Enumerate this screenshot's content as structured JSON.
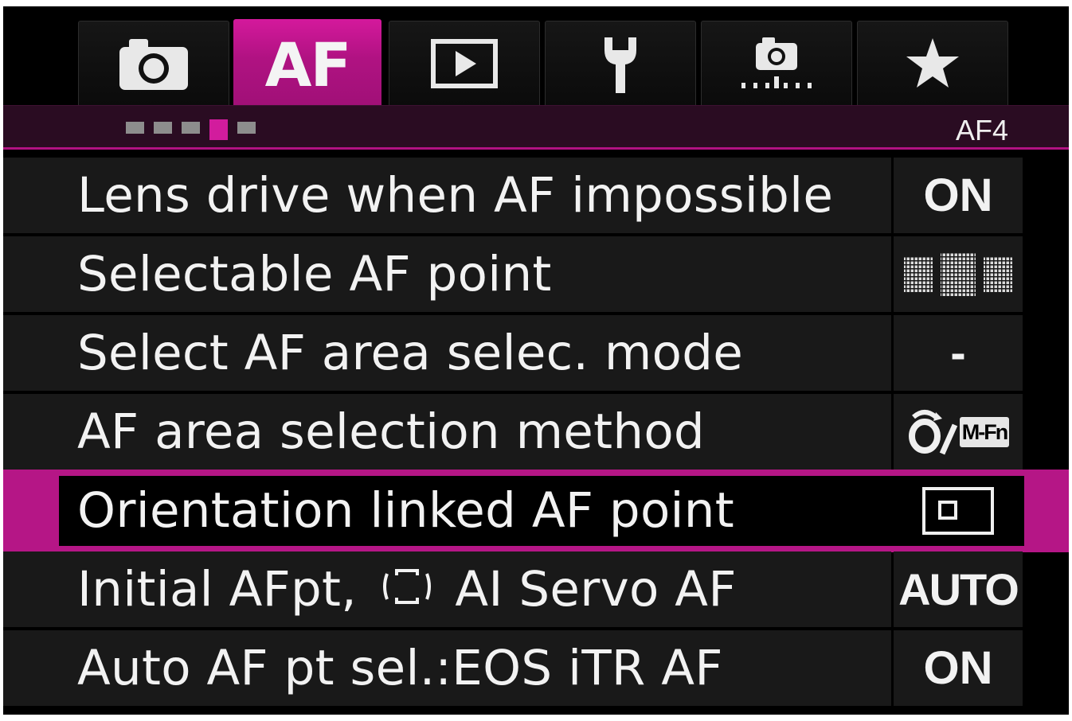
{
  "tabs": [
    {
      "id": "shooting",
      "icon": "camera-icon",
      "label": ""
    },
    {
      "id": "af",
      "icon": "",
      "label": "AF",
      "active": true
    },
    {
      "id": "playback",
      "icon": "playback-icon",
      "label": ""
    },
    {
      "id": "setup",
      "icon": "wrench-icon",
      "label": ""
    },
    {
      "id": "custom-functions",
      "icon": "custom-camera-icon",
      "label": ""
    },
    {
      "id": "my-menu",
      "icon": "star-icon",
      "label": ""
    }
  ],
  "subtabs": {
    "count": 5,
    "active_index": 3,
    "page_label": "AF4"
  },
  "menu": {
    "items": [
      {
        "label": "Lens drive when AF impossible",
        "value": "ON"
      },
      {
        "label": "Selectable AF point",
        "value": "",
        "value_icon": "af-point-grid-icon"
      },
      {
        "label": "Select AF area selec. mode",
        "value": "-"
      },
      {
        "label": "AF area selection method",
        "value": "",
        "value_icon": "dial-mfn-icon",
        "value_text": "M-Fn"
      },
      {
        "label": "Orientation linked AF point",
        "value": "",
        "value_icon": "single-af-point-frame-icon",
        "selected": true
      },
      {
        "label": "Initial AFpt,",
        "label_icon": "ai-servo-frame-icon",
        "label_suffix": "AI Servo AF",
        "value": "AUTO"
      },
      {
        "label": "Auto AF pt sel.:EOS iTR AF",
        "value": "ON"
      }
    ]
  },
  "colors": {
    "accent": "#b51686",
    "background": "#000000",
    "row_background": "#191919",
    "text": "#f2f2f2"
  }
}
